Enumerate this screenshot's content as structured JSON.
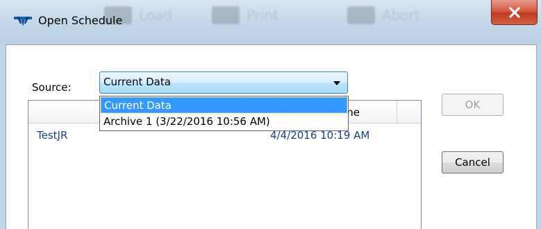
{
  "window": {
    "title": "Open Schedule",
    "app_icon": "teledyne-logo-icon",
    "close_icon": "close-icon",
    "background_toolbar": [
      {
        "label": "Load",
        "icon": "load-icon"
      },
      {
        "label": "Print",
        "icon": "printer-icon"
      },
      {
        "label": "Abort",
        "icon": "abort-icon"
      }
    ]
  },
  "source": {
    "label": "Source:",
    "selected": "Current Data",
    "options": [
      "Current Data",
      "Archive 1 (3/22/2016 10:56 AM)"
    ],
    "highlighted_index": 0
  },
  "list": {
    "columns": [
      "",
      "d Time"
    ],
    "rows": [
      {
        "name": "TestJR",
        "time": "4/4/2016 10:19 AM"
      }
    ]
  },
  "buttons": {
    "ok": "OK",
    "ok_enabled": false,
    "cancel": "Cancel"
  },
  "colors": {
    "highlight": "#3399ff",
    "close_button": "#c9452b",
    "link_text": "#1e3f8a"
  }
}
